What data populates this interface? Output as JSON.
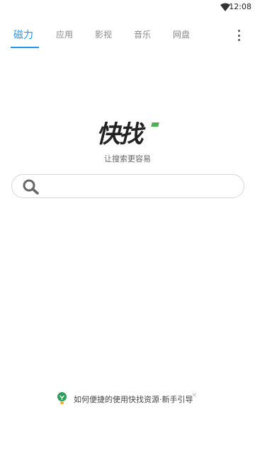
{
  "status_bar": {
    "time": "12:08",
    "wifi_icon": "wifi-icon"
  },
  "tabs": [
    {
      "label": "磁力",
      "active": true
    },
    {
      "label": "应用",
      "active": false
    },
    {
      "label": "影视",
      "active": false
    },
    {
      "label": "音乐",
      "active": false
    },
    {
      "label": "网盘",
      "active": false
    }
  ],
  "more_icon": "more-vertical-icon",
  "logo": {
    "text": "快找"
  },
  "tagline": "让搜索更容易",
  "search": {
    "value": "",
    "placeholder": "",
    "icon": "search-icon"
  },
  "guide": {
    "text": "如何便捷的使用快找资源·新手引导",
    "close": "×",
    "icon": "bulb-icon"
  },
  "colors": {
    "accent": "#2196f3",
    "logo_green": "#4caf50",
    "bulb_green": "#2e9e5b"
  }
}
